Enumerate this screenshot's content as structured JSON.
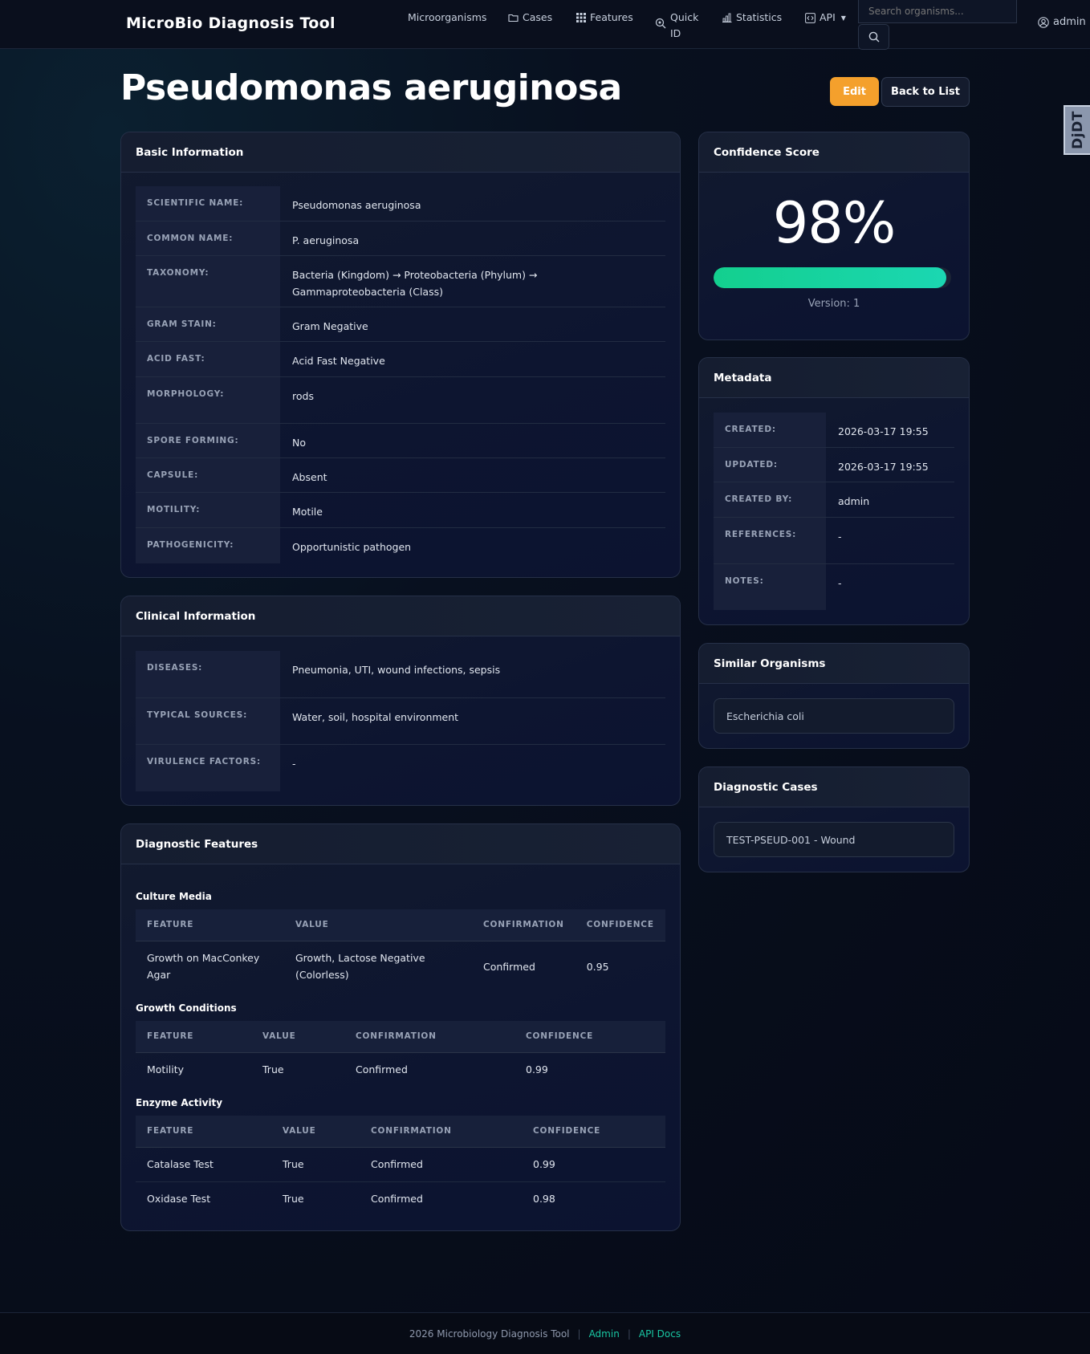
{
  "app": {
    "brand": "MicroBio Diagnosis Tool",
    "nav": [
      {
        "label": "Microorganisms",
        "icon": ""
      },
      {
        "label": "Cases",
        "icon": "folder-icon"
      },
      {
        "label": "Features",
        "icon": "grid-icon"
      },
      {
        "label": "Quick ID",
        "icon": "search-virus-icon"
      },
      {
        "label": "Statistics",
        "icon": "bar-chart-icon"
      },
      {
        "label": "API",
        "icon": "code-icon"
      }
    ],
    "search_placeholder": "Search organisms...",
    "user": "admin",
    "side_tab": "DjDT"
  },
  "page": {
    "title": "Pseudomonas aeruginosa",
    "edit_label": "Edit",
    "back_label": "Back to List"
  },
  "basic_info": {
    "title": "Basic Information",
    "rows": [
      {
        "key": "SCIENTIFIC NAME:",
        "value": "Pseudomonas aeruginosa"
      },
      {
        "key": "COMMON NAME:",
        "value": "P. aeruginosa"
      },
      {
        "key": "TAXONOMY:",
        "value": "Bacteria (Kingdom) → Proteobacteria (Phylum) → Gammaproteobacteria (Class)"
      },
      {
        "key": "GRAM STAIN:",
        "value": "Gram Negative"
      },
      {
        "key": "ACID FAST:",
        "value": "Acid Fast Negative"
      },
      {
        "key": "MORPHOLOGY:",
        "value": "rods"
      },
      {
        "key": "SPORE FORMING:",
        "value": "No"
      },
      {
        "key": "CAPSULE:",
        "value": "Absent"
      },
      {
        "key": "MOTILITY:",
        "value": "Motile"
      },
      {
        "key": "PATHOGENICITY:",
        "value": "Opportunistic pathogen"
      }
    ]
  },
  "clinical_info": {
    "title": "Clinical Information",
    "rows": [
      {
        "key": "DISEASES:",
        "value": "Pneumonia, UTI, wound infections, sepsis"
      },
      {
        "key": "TYPICAL SOURCES:",
        "value": "Water, soil, hospital environment"
      },
      {
        "key": "VIRULENCE FACTORS:",
        "value": "-"
      }
    ]
  },
  "diagnostic_features": {
    "title": "Diagnostic Features",
    "headers": [
      "FEATURE",
      "VALUE",
      "CONFIRMATION",
      "CONFIDENCE"
    ],
    "sections": [
      {
        "name": "Culture Media",
        "rows": [
          [
            "Growth on MacConkey Agar",
            "Growth, Lactose Negative (Colorless)",
            "Confirmed",
            "0.95"
          ]
        ]
      },
      {
        "name": "Growth Conditions",
        "rows": [
          [
            "Motility",
            "True",
            "Confirmed",
            "0.99"
          ]
        ]
      },
      {
        "name": "Enzyme Activity",
        "rows": [
          [
            "Catalase Test",
            "True",
            "Confirmed",
            "0.99"
          ],
          [
            "Oxidase Test",
            "True",
            "Confirmed",
            "0.98"
          ]
        ]
      }
    ]
  },
  "confidence": {
    "title": "Confidence Score",
    "value_text": "98%",
    "value": 98,
    "version": "Version: 1",
    "bar_color": "#13cf8e"
  },
  "metadata": {
    "title": "Metadata",
    "rows": [
      {
        "key": "CREATED:",
        "value": "2026-03-17 19:55"
      },
      {
        "key": "UPDATED:",
        "value": "2026-03-17 19:55"
      },
      {
        "key": "CREATED BY:",
        "value": "admin"
      },
      {
        "key": "REFERENCES:",
        "value": "-"
      },
      {
        "key": "NOTES:",
        "value": "-"
      }
    ]
  },
  "similar": {
    "title": "Similar Organisms",
    "items": [
      "Escherichia coli"
    ]
  },
  "cases": {
    "title": "Diagnostic Cases",
    "items": [
      "TEST-PSEUD-001 - Wound"
    ]
  },
  "footer": {
    "text": "2026 Microbiology Diagnosis Tool",
    "admin_link": "Admin",
    "api_link": "API Docs"
  }
}
